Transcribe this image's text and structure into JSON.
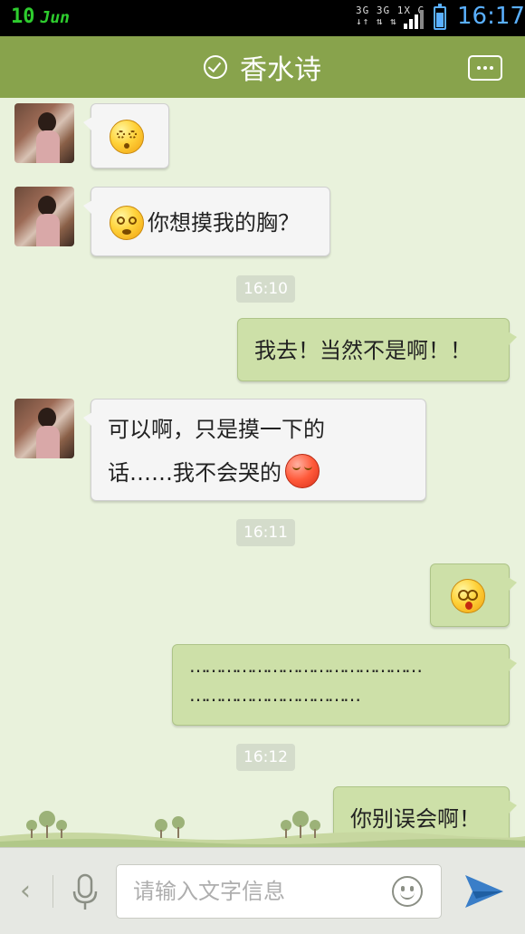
{
  "status_bar": {
    "date_day": "10",
    "date_month": "Jun",
    "network_top": "3G 3G 1X G",
    "network_bottom": "↓↑ ⇅ ⇅",
    "time": "16:17",
    "battery_level": 0.7,
    "accent_color": "#5ab0ff"
  },
  "header": {
    "title": "香水诗",
    "verified_icon": "check-circle-icon",
    "more_icon": "more-dots-icon",
    "color": "#88a34c"
  },
  "messages": [
    {
      "side": "left",
      "emoji": "dizzy-emoji",
      "text": ""
    },
    {
      "side": "left",
      "emoji": "sweat-emoji",
      "text": "你想摸我的胸？"
    },
    {
      "timestamp": "16:10"
    },
    {
      "side": "right",
      "text": "我去！当然不是啊！！"
    },
    {
      "side": "left",
      "line1": "可以啊，只是摸一下的",
      "line2": "话……我不会哭的",
      "emoji": "shy-emoji"
    },
    {
      "timestamp": "16:11"
    },
    {
      "side": "right",
      "emoji": "shocked-emoji",
      "text": ""
    },
    {
      "side": "right",
      "line1": "………………………………………",
      "line2": "……………………………"
    },
    {
      "timestamp": "16:12"
    },
    {
      "side": "right",
      "text": "你别误会啊！"
    }
  ],
  "input_bar": {
    "back_icon": "chevron-left-icon",
    "voice_icon": "microphone-icon",
    "placeholder": "请输入文字信息",
    "emoji_icon": "smiley-icon",
    "send_icon": "send-plane-icon"
  }
}
